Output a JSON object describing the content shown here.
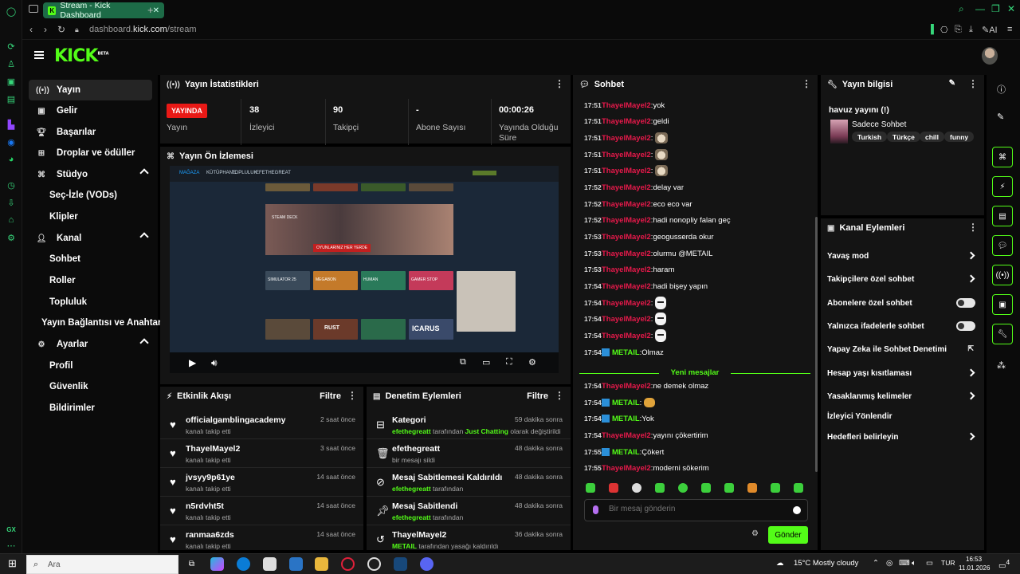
{
  "browser": {
    "tab_title": "Stream - Kick Dashboard",
    "url_prefix": "dashboard.",
    "url_domain": "kick.com",
    "url_path": "/stream",
    "ai_label": "AI"
  },
  "header": {
    "logo": "KICK",
    "logo_beta": "BETA"
  },
  "sidebar": {
    "items": [
      {
        "label": "Yayın",
        "icon": "broadcast-icon"
      },
      {
        "label": "Gelir",
        "icon": "wallet-icon"
      },
      {
        "label": "Başarılar",
        "icon": "trophy-icon"
      },
      {
        "label": "Droplar ve ödüller",
        "icon": "gift-icon"
      },
      {
        "label": "Stüdyo",
        "icon": "studio-icon"
      },
      {
        "label": "Seç-İzle (VODs)"
      },
      {
        "label": "Klipler"
      },
      {
        "label": "Kanal",
        "icon": "channel-icon"
      },
      {
        "label": "Sohbet"
      },
      {
        "label": "Roller"
      },
      {
        "label": "Topluluk"
      },
      {
        "label": "Yayın Bağlantısı ve Anahtarı"
      },
      {
        "label": "Ayarlar",
        "icon": "gear-icon"
      },
      {
        "label": "Profil"
      },
      {
        "label": "Güvenlik"
      },
      {
        "label": "Bildirimler"
      }
    ]
  },
  "stats": {
    "title": "Yayın İstatistikleri",
    "live_badge": "YAYINDA",
    "items": [
      {
        "value": "",
        "label": "Yayın"
      },
      {
        "value": "38",
        "label": "İzleyici"
      },
      {
        "value": "90",
        "label": "Takipçi"
      },
      {
        "value": "-",
        "label": "Abone Sayısı"
      },
      {
        "value": "00:00:26",
        "label": "Yayında Olduğu Süre"
      }
    ]
  },
  "preview": {
    "title": "Yayın Ön İzlemesi",
    "steam_tabs": [
      "MAĞAZA",
      "KÜTÜPHANE",
      "TOPLULUK",
      "EFETHEGREAT"
    ],
    "hero_text": "OYUNLARINIZ HER YERDE",
    "hero_logo": "STEAM DECK",
    "game_titles": [
      "SIMULATOR 25",
      "MEGABON",
      "HUMAN",
      "GAMER STOP",
      "RUST",
      "ICARUS"
    ]
  },
  "activity": {
    "title": "Etkinlik Akışı",
    "filter": "Filtre",
    "rows": [
      {
        "name": "officialgamblingacademy",
        "sub": "kanalı takip etti",
        "time": "2 saat önce"
      },
      {
        "name": "ThayelMayel2",
        "sub": "kanalı takip etti",
        "time": "3 saat önce"
      },
      {
        "name": "jvsyy9p61ye",
        "sub": "kanalı takip etti",
        "time": "14 saat önce"
      },
      {
        "name": "n5rdvht5t",
        "sub": "kanalı takip etti",
        "time": "14 saat önce"
      },
      {
        "name": "ranmaa6zds",
        "sub": "kanalı takip etti",
        "time": "14 saat önce"
      }
    ]
  },
  "moderation": {
    "title": "Denetim Eylemleri",
    "filter": "Filtre",
    "rows": [
      {
        "name": "Kategori",
        "actor": "efethegreatt",
        "mid": " tarafından ",
        "hl": "Just Chatting",
        "tail": " olarak değiştirildi",
        "time": "59 dakika sonra",
        "icon": "category-icon"
      },
      {
        "name": "efethegreatt",
        "actor": "",
        "mid": "bir mesajı sildi",
        "hl": "",
        "tail": "",
        "time": "48 dakika sonra",
        "icon": "trash-icon"
      },
      {
        "name": "Mesaj Sabitlemesi Kaldırıldı",
        "actor": "efethegreatt",
        "mid": " tarafından",
        "hl": "",
        "tail": "",
        "time": "48 dakika sonra",
        "icon": "unpin-icon"
      },
      {
        "name": "Mesaj Sabitlendi",
        "actor": "efethegreatt",
        "mid": " tarafından",
        "hl": "",
        "tail": "",
        "time": "48 dakika sonra",
        "icon": "pin-icon"
      },
      {
        "name": "ThayelMayel2",
        "actor": "METAIL",
        "mid": " tarafından yasağı kaldırıldı",
        "hl": "",
        "tail": "",
        "time": "36 dakika sonra",
        "icon": "undo-icon"
      }
    ]
  },
  "chat": {
    "title": "Sohbet",
    "new_messages": "Yeni mesajlar",
    "placeholder": "Bir mesaj gönderin",
    "send": "Gönder",
    "colors": {
      "red_user": "#e8194b",
      "green_user": "#53fc18"
    },
    "messages": [
      {
        "t": "17:51",
        "u": "ThayelMayel2",
        "c": "red",
        "m": "yok"
      },
      {
        "t": "17:51",
        "u": "ThayelMayel2",
        "c": "red",
        "m": "geldi"
      },
      {
        "t": "17:51",
        "u": "ThayelMayel2",
        "c": "red",
        "m": "",
        "e": "cat"
      },
      {
        "t": "17:51",
        "u": "ThayelMayel2",
        "c": "red",
        "m": "",
        "e": "cat"
      },
      {
        "t": "17:51",
        "u": "ThayelMayel2",
        "c": "red",
        "m": "",
        "e": "cat"
      },
      {
        "t": "17:52",
        "u": "ThayelMayel2",
        "c": "red",
        "m": "delay var"
      },
      {
        "t": "17:52",
        "u": "ThayelMayel2",
        "c": "red",
        "m": "eco eco var"
      },
      {
        "t": "17:52",
        "u": "ThayelMayel2",
        "c": "red",
        "m": "hadi nonopliy falan geç"
      },
      {
        "t": "17:53",
        "u": "ThayelMayel2",
        "c": "red",
        "m": "geogusserda okur"
      },
      {
        "t": "17:53",
        "u": "ThayelMayel2",
        "c": "red",
        "m": "olurmu @METAIL"
      },
      {
        "t": "17:53",
        "u": "ThayelMayel2",
        "c": "red",
        "m": "haram"
      },
      {
        "t": "17:54",
        "u": "ThayelMayel2",
        "c": "red",
        "m": "hadi bişey yapın"
      },
      {
        "t": "17:54",
        "u": "ThayelMayel2",
        "c": "red",
        "m": "",
        "e": "mask"
      },
      {
        "t": "17:54",
        "u": "ThayelMayel2",
        "c": "red",
        "m": "",
        "e": "mask"
      },
      {
        "t": "17:54",
        "u": "ThayelMayel2",
        "c": "red",
        "m": "",
        "e": "mask"
      },
      {
        "t": "17:54",
        "u": "METAIL",
        "c": "green",
        "m": "Olmaz",
        "b": true
      },
      {
        "t": "17:54",
        "u": "ThayelMayel2",
        "c": "red",
        "m": "ne demek olmaz"
      },
      {
        "t": "17:54",
        "u": "METAIL",
        "c": "green",
        "m": "",
        "b": true,
        "e": "burger"
      },
      {
        "t": "17:54",
        "u": "METAIL",
        "c": "green",
        "m": "Yok",
        "b": true
      },
      {
        "t": "17:54",
        "u": "ThayelMayel2",
        "c": "red",
        "m": "yayını çökertirim"
      },
      {
        "t": "17:55",
        "u": "METAIL",
        "c": "green",
        "m": "Çökert",
        "b": true
      },
      {
        "t": "17:55",
        "u": "ThayelMayel2",
        "c": "red",
        "m": "moderni sökerim"
      }
    ]
  },
  "info": {
    "title": "Yayın bilgisi",
    "stream_title": "havuz yayını (!)",
    "category": "Sadece Sohbet",
    "tags": [
      "Turkish",
      "Türkçe",
      "chill",
      "funny"
    ]
  },
  "actions": {
    "title": "Kanal Eylemleri",
    "rows": [
      {
        "label": "Yavaş mod",
        "kind": "chevron"
      },
      {
        "label": "Takipçilere özel sohbet",
        "kind": "chevron"
      },
      {
        "label": "Abonelere özel sohbet",
        "kind": "toggle"
      },
      {
        "label": "Yalnızca ifadelerle sohbet",
        "kind": "toggle"
      },
      {
        "label": "Yapay Zeka ile Sohbet Denetimi",
        "kind": "external"
      },
      {
        "label": "Hesap yaşı kısıtlaması",
        "kind": "chevron"
      },
      {
        "label": "Yasaklanmış kelimeler",
        "kind": "chevron"
      },
      {
        "label": "İzleyici Yönlendir",
        "kind": "none"
      },
      {
        "label": "Hedefleri belirleyin",
        "kind": "chevron"
      }
    ]
  },
  "taskbar": {
    "search": "Ara",
    "weather": "15°C  Mostly cloudy",
    "lang": "TUR",
    "time": "16:53",
    "date": "11.01.2026",
    "notif": "4"
  }
}
